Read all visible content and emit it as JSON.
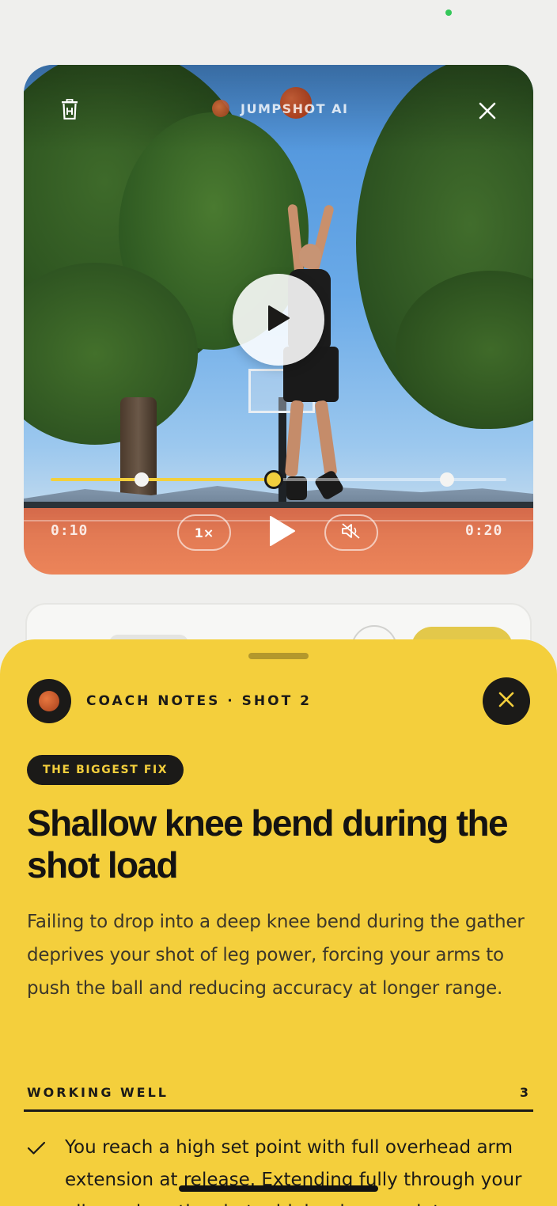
{
  "video": {
    "brand_name": "JUMPSHOT AI",
    "time_start": "0:10",
    "time_end": "0:20",
    "speed_label": "1×",
    "playback_progress": 0.49,
    "trim_start": 0.2,
    "trim_end": 0.87,
    "accent_color": "#f2cf3d",
    "icons": {
      "trash": "trash-icon",
      "close": "close-icon",
      "play": "play-icon",
      "mute": "mute-icon"
    }
  },
  "sheet": {
    "title": "COACH NOTES · SHOT 2",
    "background_color": "#f4cf3c",
    "badge": "THE BIGGEST FIX",
    "fix_title": "Shallow knee bend during the shot load",
    "fix_body": "Failing to drop into a deep knee bend during the gather deprives your shot of leg power, forcing your arms to push the ball and reducing accuracy at longer range.",
    "working_well": {
      "label": "WORKING WELL",
      "count": "3",
      "items": [
        {
          "text": "You reach a high set point with full overhead arm extension at release. Extending fully through your elbow gives the shot a high release point"
        }
      ]
    }
  }
}
